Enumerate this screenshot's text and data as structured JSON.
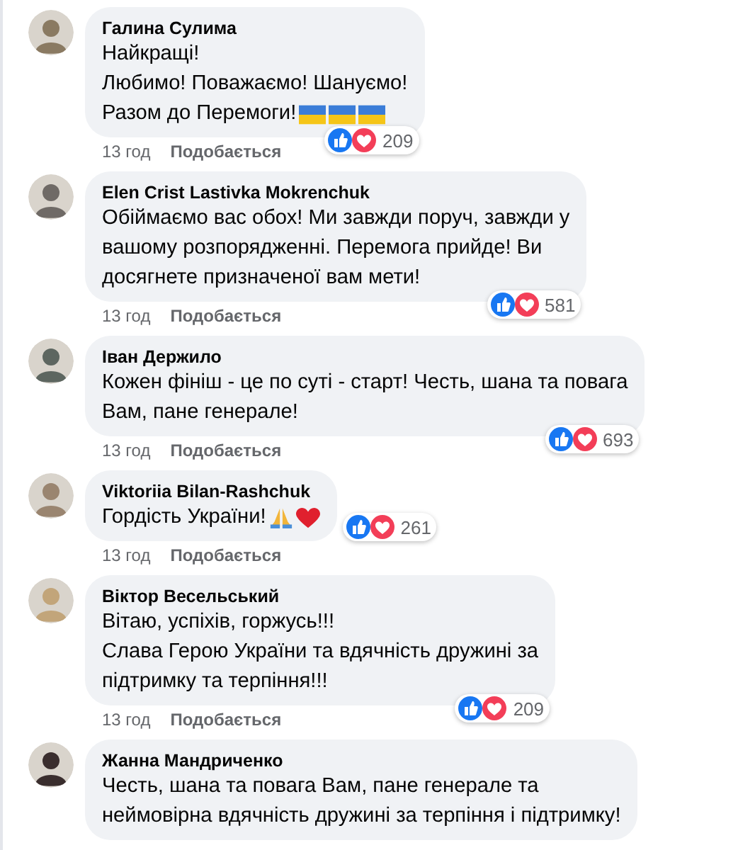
{
  "comments": [
    {
      "author": "Галина Сулима",
      "lines": [
        "Найкращі!",
        "Любимо! Поважаємо! Шануємо!",
        "Разом до Перемоги!"
      ],
      "emoji": [
        {
          "kind": "flag"
        },
        {
          "kind": "flag"
        },
        {
          "kind": "flag"
        }
      ],
      "reactions": "209",
      "time": "13 год",
      "like_label": "Подобається"
    },
    {
      "author": "Elen Crist Lastivka Mokrenchuk",
      "lines": [
        "Обіймаємо вас обох! Ми завжди поруч, завжди у",
        "вашому розпорядженні. Перемога прийде! Ви",
        "досягнете призначеної вам мети!"
      ],
      "reactions": "581",
      "time": "13 год",
      "like_label": "Подобається"
    },
    {
      "author": "Іван Держило",
      "lines": [
        "Кожен фініш - це по суті - старт! Честь, шана та повага",
        "Вам, пане генерале!"
      ],
      "reactions": "693",
      "time": "13 год",
      "like_label": "Подобається"
    },
    {
      "author": "Viktoriia Bilan-Rashchuk",
      "lines": [
        "Гордість України!"
      ],
      "emoji": [
        {
          "kind": "pray"
        },
        {
          "kind": "heart"
        }
      ],
      "reactions": "261",
      "time": "13 год",
      "like_label": "Подобається"
    },
    {
      "author": "Віктор Весельський",
      "lines": [
        "Вітаю, успіхів, горжусь!!!",
        "Слава Герою України та вдячність дружині за",
        "підтримку та терпіння!!!"
      ],
      "reactions": "209",
      "time": "13 год",
      "like_label": "Подобається"
    },
    {
      "author": "Жанна Мандриченко",
      "lines": [
        "Честь, шана та повага Вам, пане генерале та",
        "неймовірна вдячність дружині за терпіння і підтримку!"
      ]
    }
  ]
}
